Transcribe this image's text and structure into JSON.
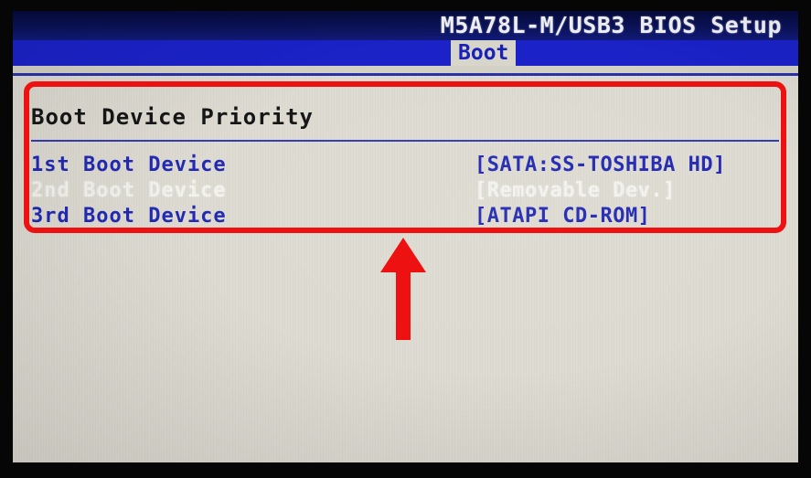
{
  "screen": {
    "bios_title": "M5A78L-M/USB3 BIOS Setup",
    "active_tab": "Boot",
    "section_heading": "Boot Device Priority"
  },
  "boot_devices": [
    {
      "label": "1st Boot Device",
      "value": "[SATA:SS-TOSHIBA HD]",
      "tone": "blue"
    },
    {
      "label": "2nd Boot Device",
      "value": "[Removable Dev.]",
      "tone": "white"
    },
    {
      "label": "3rd Boot Device",
      "value": "[ATAPI CD-ROM]",
      "tone": "blue"
    }
  ],
  "annotations": {
    "highlight_color": "#ee1111",
    "arrow_icon": "up-arrow-icon",
    "box_icon": "highlight-rectangle-icon"
  },
  "colors": {
    "title_band": "#0b1258",
    "tab_bar": "#1b22c8",
    "panel": "#dedbd2",
    "text_blue": "#2128b4",
    "text_white": "#f4f3ee",
    "text_black": "#141414"
  }
}
